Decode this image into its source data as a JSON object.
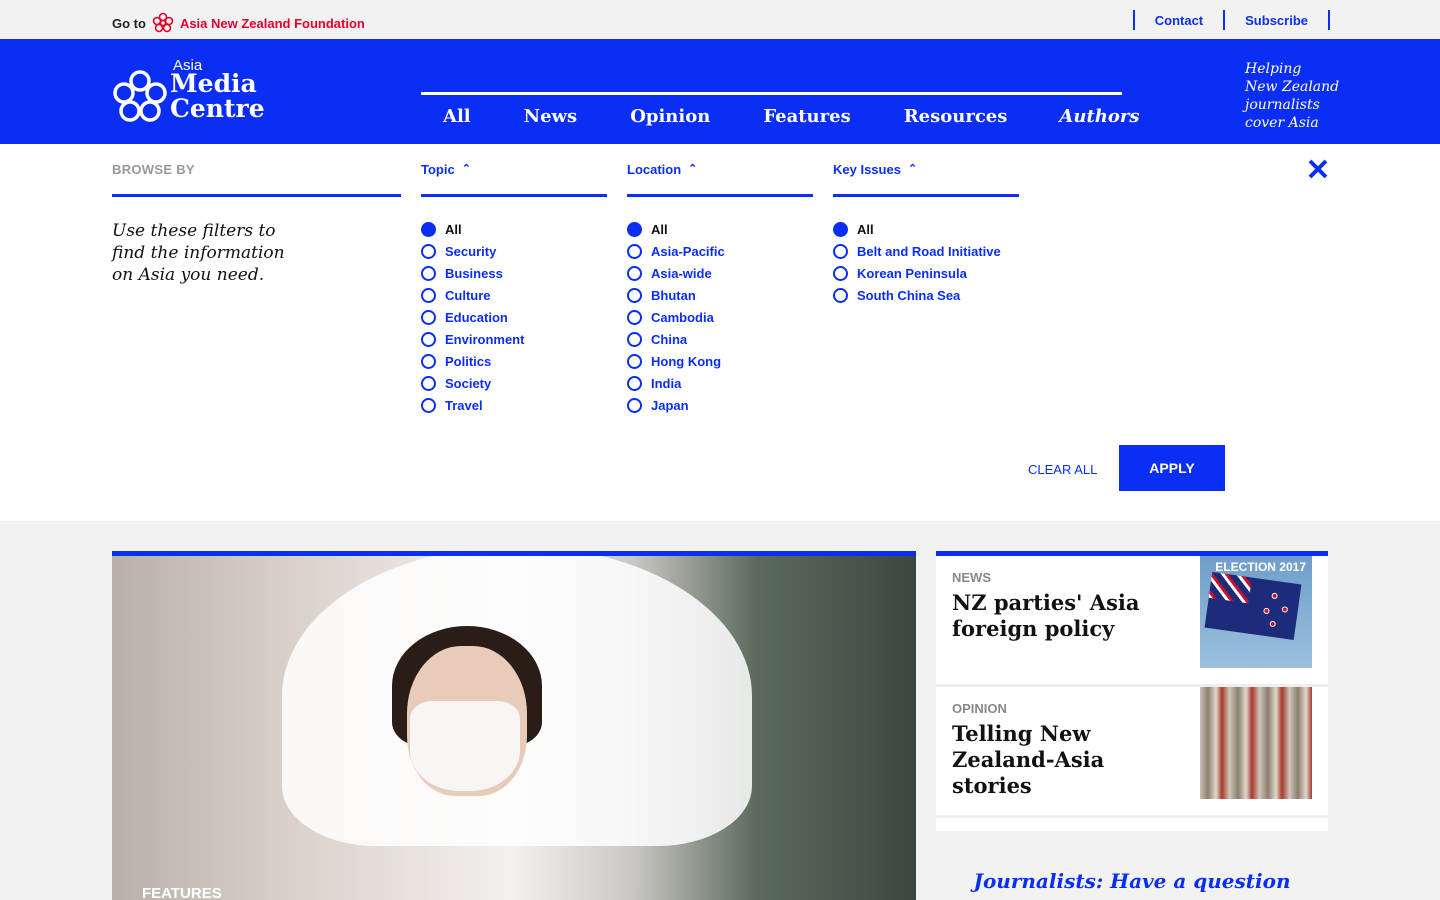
{
  "topbar": {
    "goto_label": "Go to",
    "foundation_label": "Asia New Zealand Foundation",
    "contact": "Contact",
    "subscribe": "Subscribe"
  },
  "logo": {
    "small": "Asia",
    "line1": "Media",
    "line2": "Centre"
  },
  "nav": {
    "items": [
      "All",
      "News",
      "Opinion",
      "Features",
      "Resources"
    ],
    "authors": "Authors",
    "search_icon": "search-icon"
  },
  "tagline": [
    "Helping",
    "New Zealand",
    "journalists",
    "cover Asia"
  ],
  "filters": {
    "browse_by": "BROWSE BY",
    "browse_text": [
      "Use these filters to",
      "find the information",
      "on Asia you need."
    ],
    "topic": {
      "label": "Topic",
      "options": [
        "All",
        "Security",
        "Business",
        "Culture",
        "Education",
        "Environment",
        "Politics",
        "Society",
        "Travel"
      ],
      "selected": "All"
    },
    "location": {
      "label": "Location",
      "options": [
        "All",
        "Asia-Pacific",
        "Asia-wide",
        "Bhutan",
        "Cambodia",
        "China",
        "Hong Kong",
        "India",
        "Japan"
      ],
      "selected": "All"
    },
    "key_issues": {
      "label": "Key Issues",
      "options": [
        "All",
        "Belt and Road Initiative",
        "Korean Peninsula",
        "South China Sea"
      ],
      "selected": "All"
    },
    "clear_all": "CLEAR ALL",
    "apply": "APPLY"
  },
  "hero": {
    "category": "FEATURES"
  },
  "side_cards": [
    {
      "category": "NEWS",
      "title": "NZ parties' Asia foreign policy",
      "thumb_text": "ELECTION 2017"
    },
    {
      "category": "OPINION",
      "title": "Telling New Zealand-Asia stories"
    }
  ],
  "journalists_prompt": "Journalists: Have a question",
  "colors": {
    "brand_blue": "#0b2ef5",
    "foundation_red": "#e4002b"
  }
}
